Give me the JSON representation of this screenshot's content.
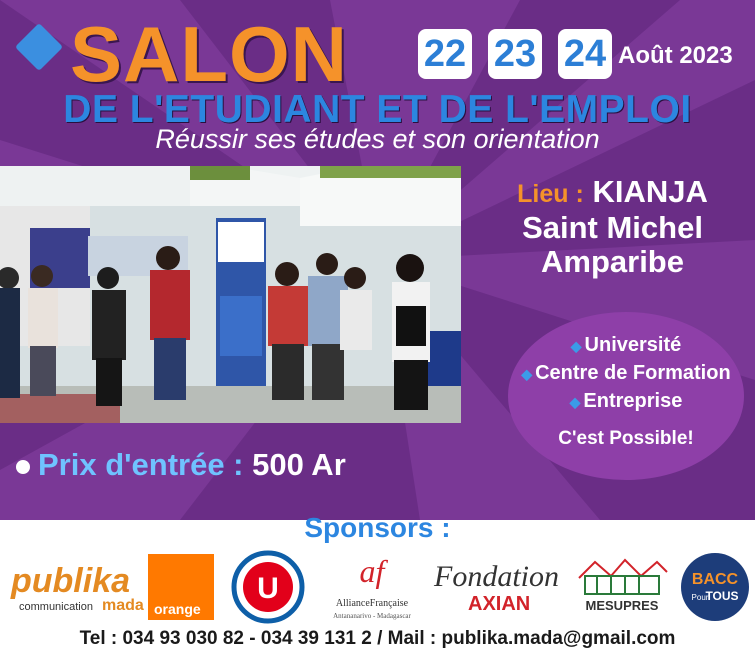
{
  "header": {
    "title": "SALON",
    "days": [
      "22",
      "23",
      "24"
    ],
    "month": "Août 2023",
    "subtitle": "DE L'ETUDIANT ET DE L'EMPLOI",
    "tagline": "Réussir  ses études et son orientation"
  },
  "location": {
    "label": "Lieu :",
    "line1": "KIANJA",
    "line2": "Saint Michel",
    "line3": "Amparibe"
  },
  "options": {
    "items": [
      "Université",
      "Centre de Formation",
      "Entreprise"
    ],
    "tagline": "C'est Possible!"
  },
  "price": {
    "label": "Prix d'entrée :",
    "value": "500 Ar"
  },
  "sponsors": {
    "title": "Sponsors :",
    "publika_main": "publika",
    "publika_sub": "communication",
    "publika_mada": "mada",
    "orange": "orange",
    "u_letter": "U",
    "af_letters": "af",
    "af_name": "AllianceFrançaise",
    "af_city": "Antananarivo - Madagascar",
    "fondation_word": "Fondation",
    "axian_word": "AXIAN",
    "mesupres_word": "MESUPRES",
    "bacc_word": "BACC",
    "pour_word": "Pour",
    "tous_word": "TOUS"
  },
  "footer": {
    "contact": "Tel : 034 93 030 82 - 034 39 131 2 / Mail : publika.mada@gmail.com"
  },
  "colors": {
    "purple_bg": "#6a2d86",
    "orange": "#f5922a",
    "blue": "#2c86e0",
    "circle": "#8e3fa8"
  }
}
